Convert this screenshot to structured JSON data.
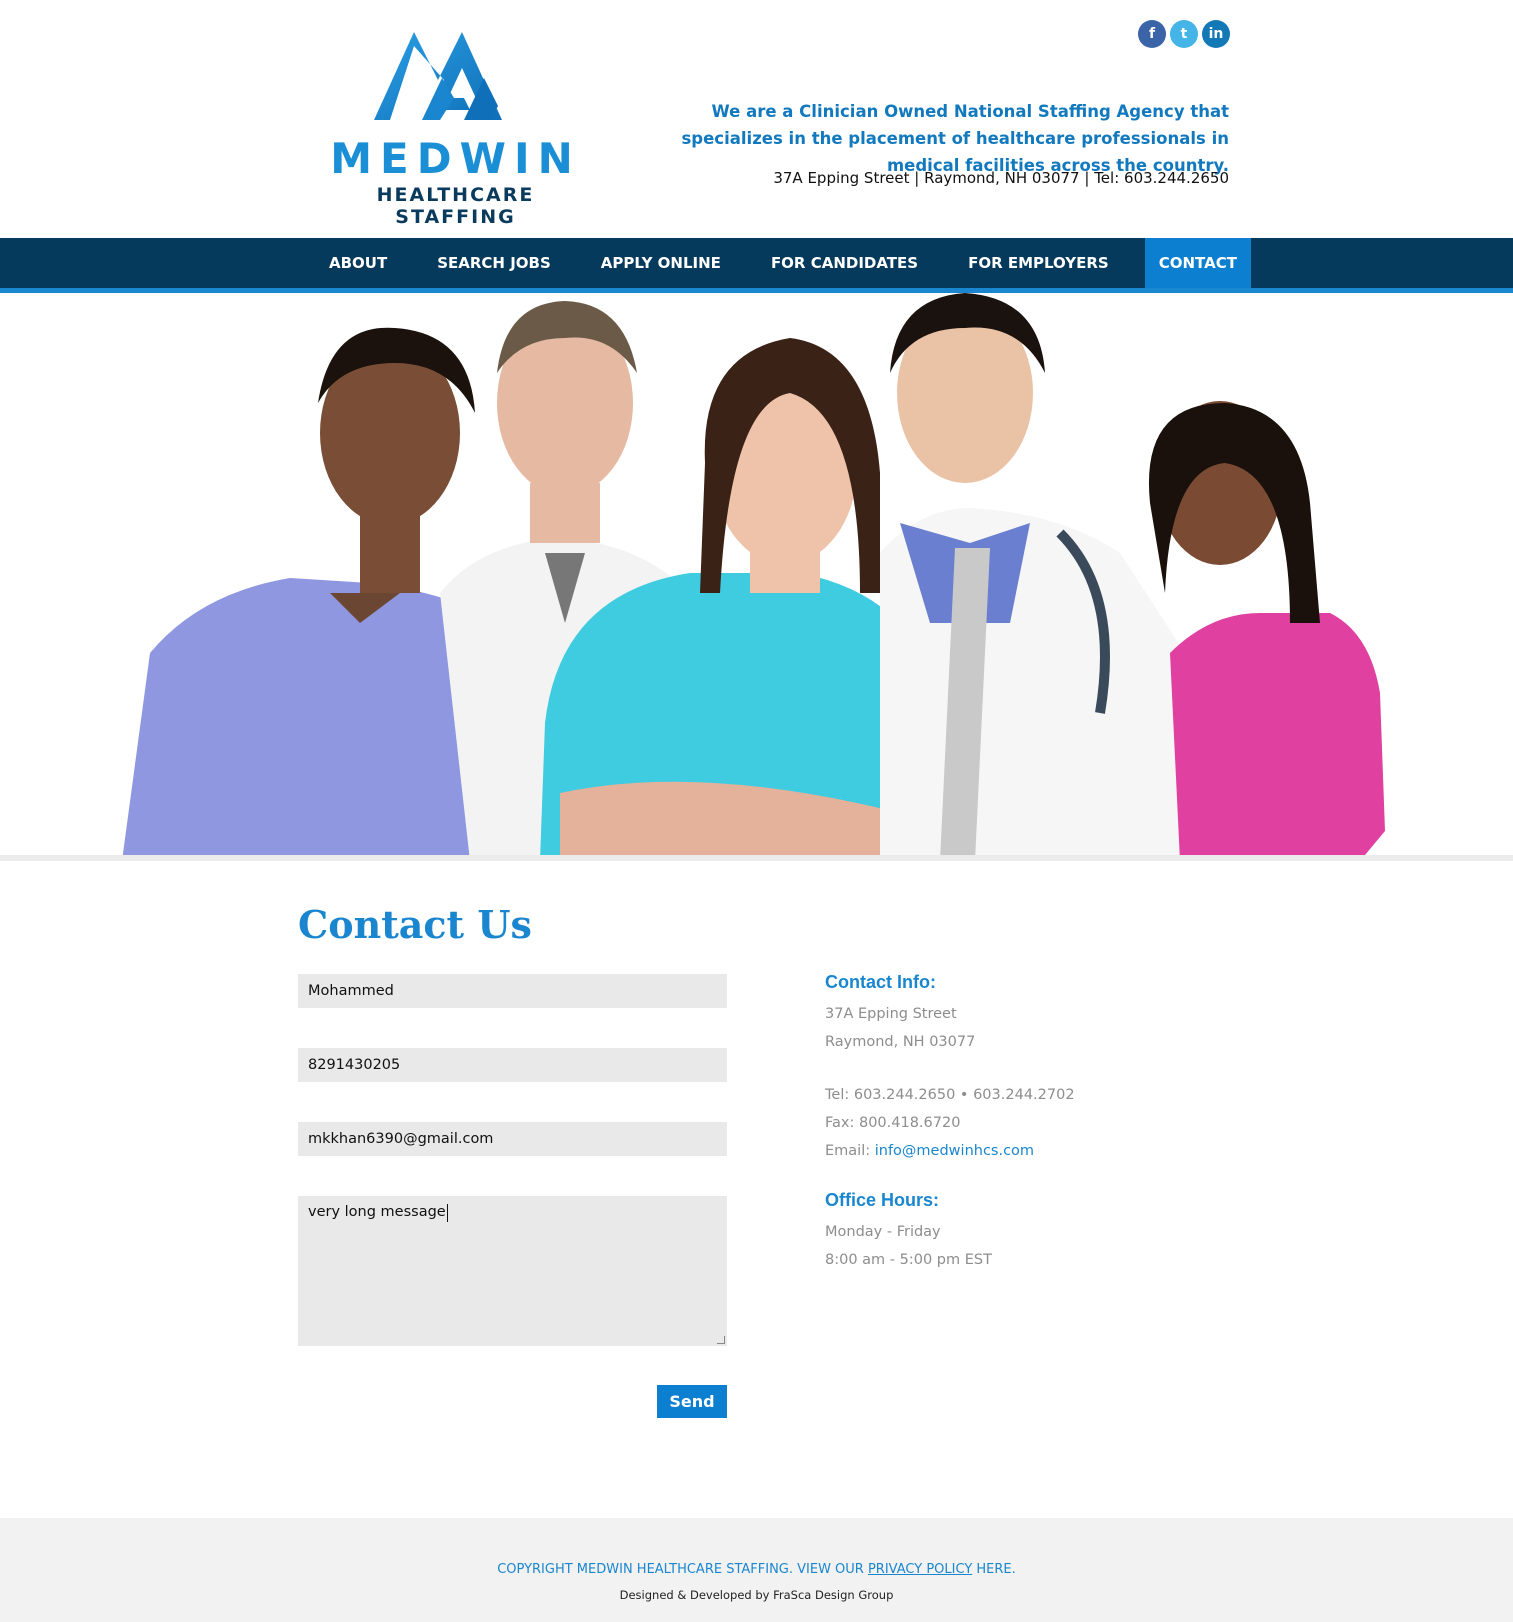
{
  "header": {
    "logo_name": "MEDWIN",
    "logo_sub": "HEALTHCARE STAFFING",
    "tagline": "We are a Clinician Owned National Staffing Agency that specializes in the placement of healthcare professionals in medical facilities across the country.",
    "address_line": "37A Epping Street | Raymond, NH 03077 | Tel: 603.244.2650",
    "social": [
      {
        "icon": "facebook-icon",
        "glyph": "f"
      },
      {
        "icon": "twitter-icon",
        "glyph": "t"
      },
      {
        "icon": "linkedin-icon",
        "glyph": "in"
      }
    ]
  },
  "nav": {
    "items": [
      {
        "label": "ABOUT"
      },
      {
        "label": "SEARCH JOBS"
      },
      {
        "label": "APPLY ONLINE"
      },
      {
        "label": "FOR CANDIDATES"
      },
      {
        "label": "FOR EMPLOYERS"
      },
      {
        "label": "CONTACT",
        "active": true
      }
    ]
  },
  "contact": {
    "title": "Contact Us",
    "form": {
      "name_value": "Mohammed",
      "phone_value": "8291430205",
      "email_value": "mkkhan6390@gmail.com",
      "message_value": "very long message",
      "send_label": "Send"
    },
    "info": {
      "heading": "Contact Info:",
      "street": "37A Epping Street",
      "city": "Raymond, NH 03077",
      "tel": "Tel: 603.244.2650 • 603.244.2702",
      "fax": "Fax: 800.418.6720",
      "email_label": "Email: ",
      "email_link": "info@medwinhcs.com",
      "hours_heading": "Office Hours:",
      "days": "Monday - Friday",
      "hours": "8:00 am - 5:00 pm EST"
    }
  },
  "footer": {
    "copy_prefix": "COPYRIGHT MEDWIN HEALTHCARE STAFFING. VIEW OUR ",
    "privacy_link": "PRIVACY POLICY",
    "copy_suffix": " HERE.",
    "credit": "Designed & Developed by FraSca Design Group"
  },
  "colors": {
    "brand_blue": "#1a86cf",
    "nav_dark": "#063a5c",
    "field_bg": "#e9e9e9"
  }
}
